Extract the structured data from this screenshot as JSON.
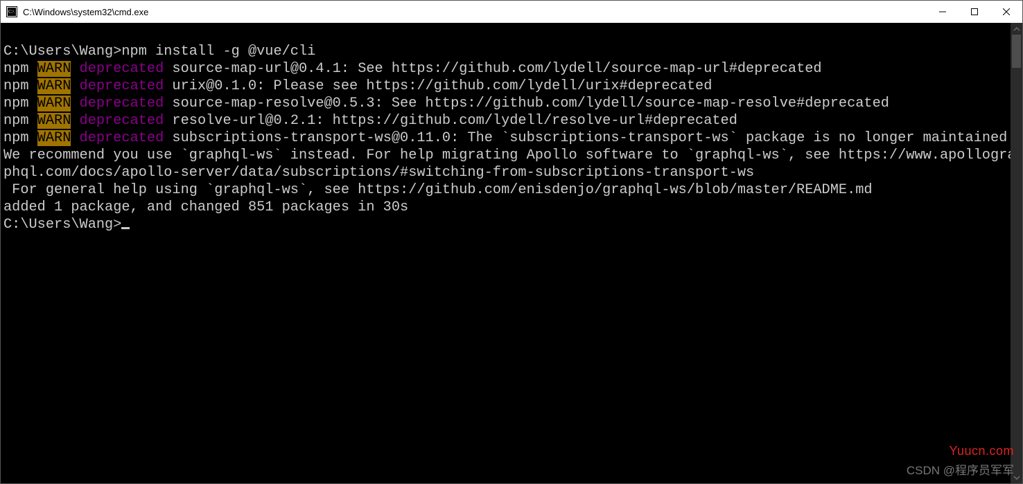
{
  "window": {
    "title": "C:\\Windows\\system32\\cmd.exe"
  },
  "terminal": {
    "prompt1": "C:\\Users\\Wang>",
    "command1": "npm install -g @vue/cli",
    "npm_label": "npm ",
    "warn_label": "WARN",
    "deprecated_label": " deprecated",
    "warn1_rest": " source-map-url@0.4.1: See https://github.com/lydell/source-map-url#deprecated",
    "warn2_rest": " urix@0.1.0: Please see https://github.com/lydell/urix#deprecated",
    "warn3_rest": " source-map-resolve@0.5.3: See https://github.com/lydell/source-map-resolve#deprecated",
    "warn4_rest": " resolve-url@0.2.1: https://github.com/lydell/resolve-url#deprecated",
    "warn5_rest": " subscriptions-transport-ws@0.11.0: The `subscriptions-transport-ws` package is no longer maintained. We recommend you use `graphql-ws` instead. For help migrating Apollo software to `graphql-ws`, see https://www.apollographql.com/docs/apollo-server/data/subscriptions/#switching-from-subscriptions-transport-ws\n For general help using `graphql-ws`, see https://github.com/enisdenjo/graphql-ws/blob/master/README.md",
    "blank": "",
    "result": "added 1 package, and changed 851 packages in 30s",
    "prompt2": "C:\\Users\\Wang>"
  },
  "watermarks": {
    "site": "Yuucn.com",
    "author": "CSDN @程序员军军"
  }
}
